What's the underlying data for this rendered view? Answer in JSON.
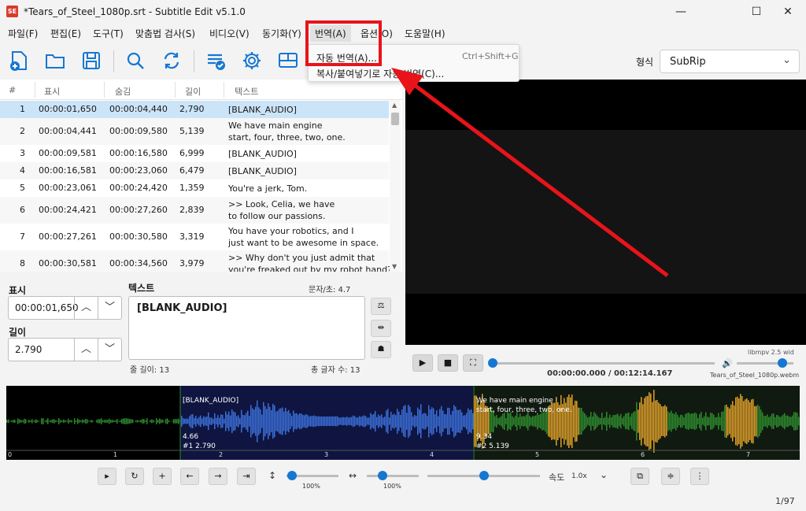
{
  "window": {
    "title": "*Tears_of_Steel_1080p.srt - Subtitle Edit v5.1.0",
    "app_icon": "SE",
    "minimize": "—",
    "maximize": "☐",
    "close": "✕"
  },
  "menu": [
    "파일(F)",
    "편집(E)",
    "도구(T)",
    "맞춤법 검사(S)",
    "비디오(V)",
    "동기화(Y)",
    "번역(A)",
    "옵션(O)",
    "도움말(H)"
  ],
  "dropdown": {
    "items": [
      {
        "label": "자동 번역(A)...",
        "shortcut": "Ctrl+Shift+G"
      },
      {
        "label": "복사/붙여넣기로 자동 번역(C)..."
      }
    ]
  },
  "toolbar": {
    "icons": [
      "new-file-icon",
      "open-folder-icon",
      "save-icon",
      "find-icon",
      "replace-icon",
      "spell-check-icon",
      "settings-icon",
      "layout-icon"
    ]
  },
  "format": {
    "label": "형식",
    "value": "SubRip"
  },
  "grid": {
    "columns": [
      "#",
      "표시",
      "숨김",
      "길이",
      "텍스트"
    ],
    "rows": [
      {
        "num": "1",
        "show": "00:00:01,650",
        "hide": "00:00:04,440",
        "dur": "2,790",
        "text": [
          "[BLANK_AUDIO]"
        ]
      },
      {
        "num": "2",
        "show": "00:00:04,441",
        "hide": "00:00:09,580",
        "dur": "5,139",
        "text": [
          "We have main engine",
          "start, four, three, two, one."
        ]
      },
      {
        "num": "3",
        "show": "00:00:09,581",
        "hide": "00:00:16,580",
        "dur": "6,999",
        "text": [
          "[BLANK_AUDIO]"
        ]
      },
      {
        "num": "4",
        "show": "00:00:16,581",
        "hide": "00:00:23,060",
        "dur": "6,479",
        "text": [
          "[BLANK_AUDIO]"
        ]
      },
      {
        "num": "5",
        "show": "00:00:23,061",
        "hide": "00:00:24,420",
        "dur": "1,359",
        "text": [
          "You're a jerk, Tom."
        ]
      },
      {
        "num": "6",
        "show": "00:00:24,421",
        "hide": "00:00:27,260",
        "dur": "2,839",
        "text": [
          ">> Look, Celia, we have",
          "to follow our passions."
        ]
      },
      {
        "num": "7",
        "show": "00:00:27,261",
        "hide": "00:00:30,580",
        "dur": "3,319",
        "text": [
          "You have your robotics, and I",
          "just want to be awesome in space."
        ]
      },
      {
        "num": "8",
        "show": "00:00:30,581",
        "hide": "00:00:34,560",
        "dur": "3,979",
        "text": [
          ">> Why don't you just admit that",
          "you're freaked out by my robot hand?"
        ]
      }
    ]
  },
  "editor": {
    "show_label": "표시",
    "show_value": "00:00:01,650",
    "dur_label": "길이",
    "dur_value": "2.790",
    "text_label": "텍스트",
    "chars_per_sec": "문자/초: 4.7",
    "text_value": "[BLANK_AUDIO]",
    "line_length": "줄 길이: 13",
    "total_chars": "총 글자 수: 13"
  },
  "player": {
    "engine": "libmpv 2.5 wid",
    "time": "00:00:00.000 / 00:12:14.167",
    "filename": "Tears_of_Steel_1080p.webm",
    "position": 0.0,
    "volume": 0.8
  },
  "waveform": {
    "segments": [
      {
        "text": "[BLANK_AUDIO]",
        "start_label": "4.66",
        "info": "#1  2.790"
      },
      {
        "text": [
          "We have main engine",
          "start, four, three, two, one."
        ],
        "start_label": "9.34",
        "info": "#2  5.139"
      }
    ],
    "ticks": [
      "0",
      "1",
      "2",
      "3",
      "4",
      "5",
      "6",
      "7"
    ]
  },
  "bottom": {
    "zoom_v": "100%",
    "zoom_h": "100%",
    "speed_label": "속도",
    "speed_value": "1.0x",
    "page": "1/97",
    "zoom_v_level": 0.1,
    "zoom_h_level": 0.3,
    "speed_level": 0.5
  },
  "colors": {
    "selected_row": "#cce4f7",
    "accent": "#1677d2",
    "highlight": "#e8141a",
    "wave_blue": "#3b6fd8",
    "wave_green": "#2e8b2e",
    "wave_orange": "#e0a02a"
  }
}
